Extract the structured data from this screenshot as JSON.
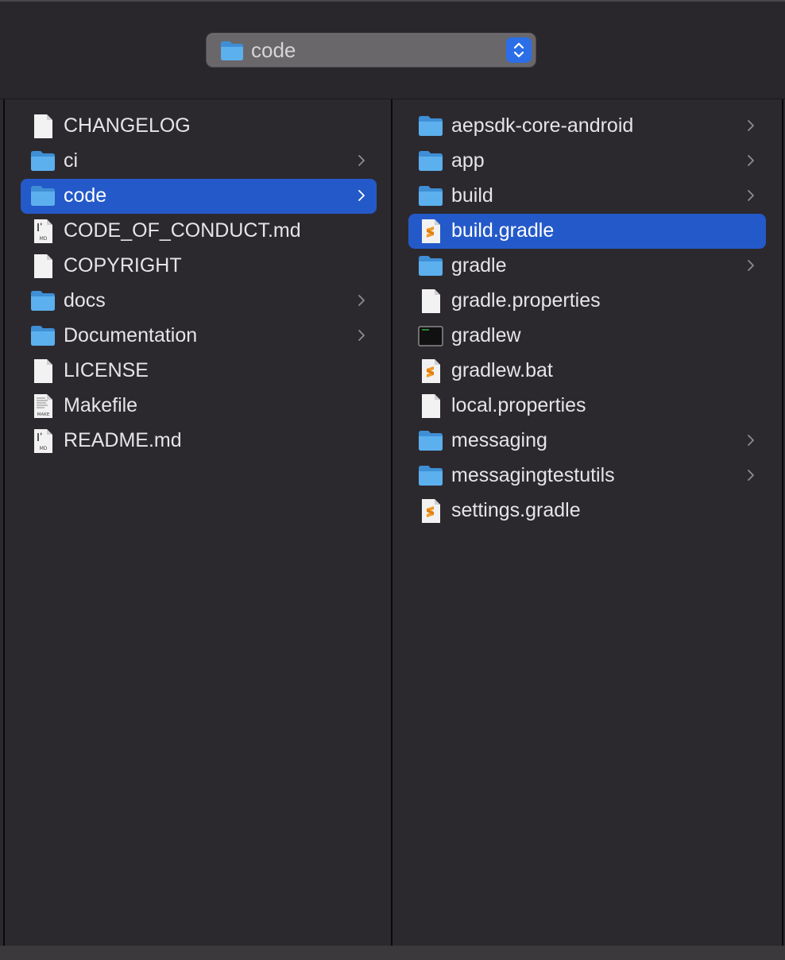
{
  "path_popup": {
    "label": "code",
    "icon": "folder-icon",
    "stepper_icon": "chevron-up-down-icon"
  },
  "colors": {
    "selection": "#2459c9",
    "folder": "#4ea4e6",
    "stepper": "#2b6ee8",
    "gradle_accent": "#f29a26"
  },
  "column1": {
    "items": [
      {
        "label": "CHANGELOG",
        "icon": "document-icon",
        "chevron": false,
        "selected": false
      },
      {
        "label": "ci",
        "icon": "folder-icon",
        "chevron": true,
        "selected": false
      },
      {
        "label": "code",
        "icon": "folder-icon",
        "chevron": true,
        "selected": true
      },
      {
        "label": "CODE_OF_CONDUCT.md",
        "icon": "markdown-file-icon",
        "badge": "MD",
        "chevron": false,
        "selected": false
      },
      {
        "label": "COPYRIGHT",
        "icon": "document-icon",
        "chevron": false,
        "selected": false
      },
      {
        "label": "docs",
        "icon": "folder-icon",
        "chevron": true,
        "selected": false
      },
      {
        "label": "Documentation",
        "icon": "folder-icon",
        "chevron": true,
        "selected": false
      },
      {
        "label": "LICENSE",
        "icon": "document-icon",
        "chevron": false,
        "selected": false
      },
      {
        "label": "Makefile",
        "icon": "makefile-icon",
        "badge": "MAKE",
        "chevron": false,
        "selected": false
      },
      {
        "label": "README.md",
        "icon": "markdown-file-icon",
        "badge": "MD",
        "chevron": false,
        "selected": false
      }
    ]
  },
  "column2": {
    "items": [
      {
        "label": "aepsdk-core-android",
        "icon": "folder-icon",
        "chevron": true,
        "selected": false
      },
      {
        "label": "app",
        "icon": "folder-icon",
        "chevron": true,
        "selected": false
      },
      {
        "label": "build",
        "icon": "folder-icon",
        "chevron": true,
        "selected": false
      },
      {
        "label": "build.gradle",
        "icon": "gradle-file-icon",
        "chevron": false,
        "selected": true
      },
      {
        "label": "gradle",
        "icon": "folder-icon",
        "chevron": true,
        "selected": false
      },
      {
        "label": "gradle.properties",
        "icon": "document-icon",
        "chevron": false,
        "selected": false
      },
      {
        "label": "gradlew",
        "icon": "terminal-icon",
        "chevron": false,
        "selected": false
      },
      {
        "label": "gradlew.bat",
        "icon": "gradle-file-icon",
        "chevron": false,
        "selected": false
      },
      {
        "label": "local.properties",
        "icon": "document-icon",
        "chevron": false,
        "selected": false
      },
      {
        "label": "messaging",
        "icon": "folder-icon",
        "chevron": true,
        "selected": false
      },
      {
        "label": "messagingtestutils",
        "icon": "folder-icon",
        "chevron": true,
        "selected": false
      },
      {
        "label": "settings.gradle",
        "icon": "gradle-file-icon",
        "chevron": false,
        "selected": false
      }
    ]
  }
}
